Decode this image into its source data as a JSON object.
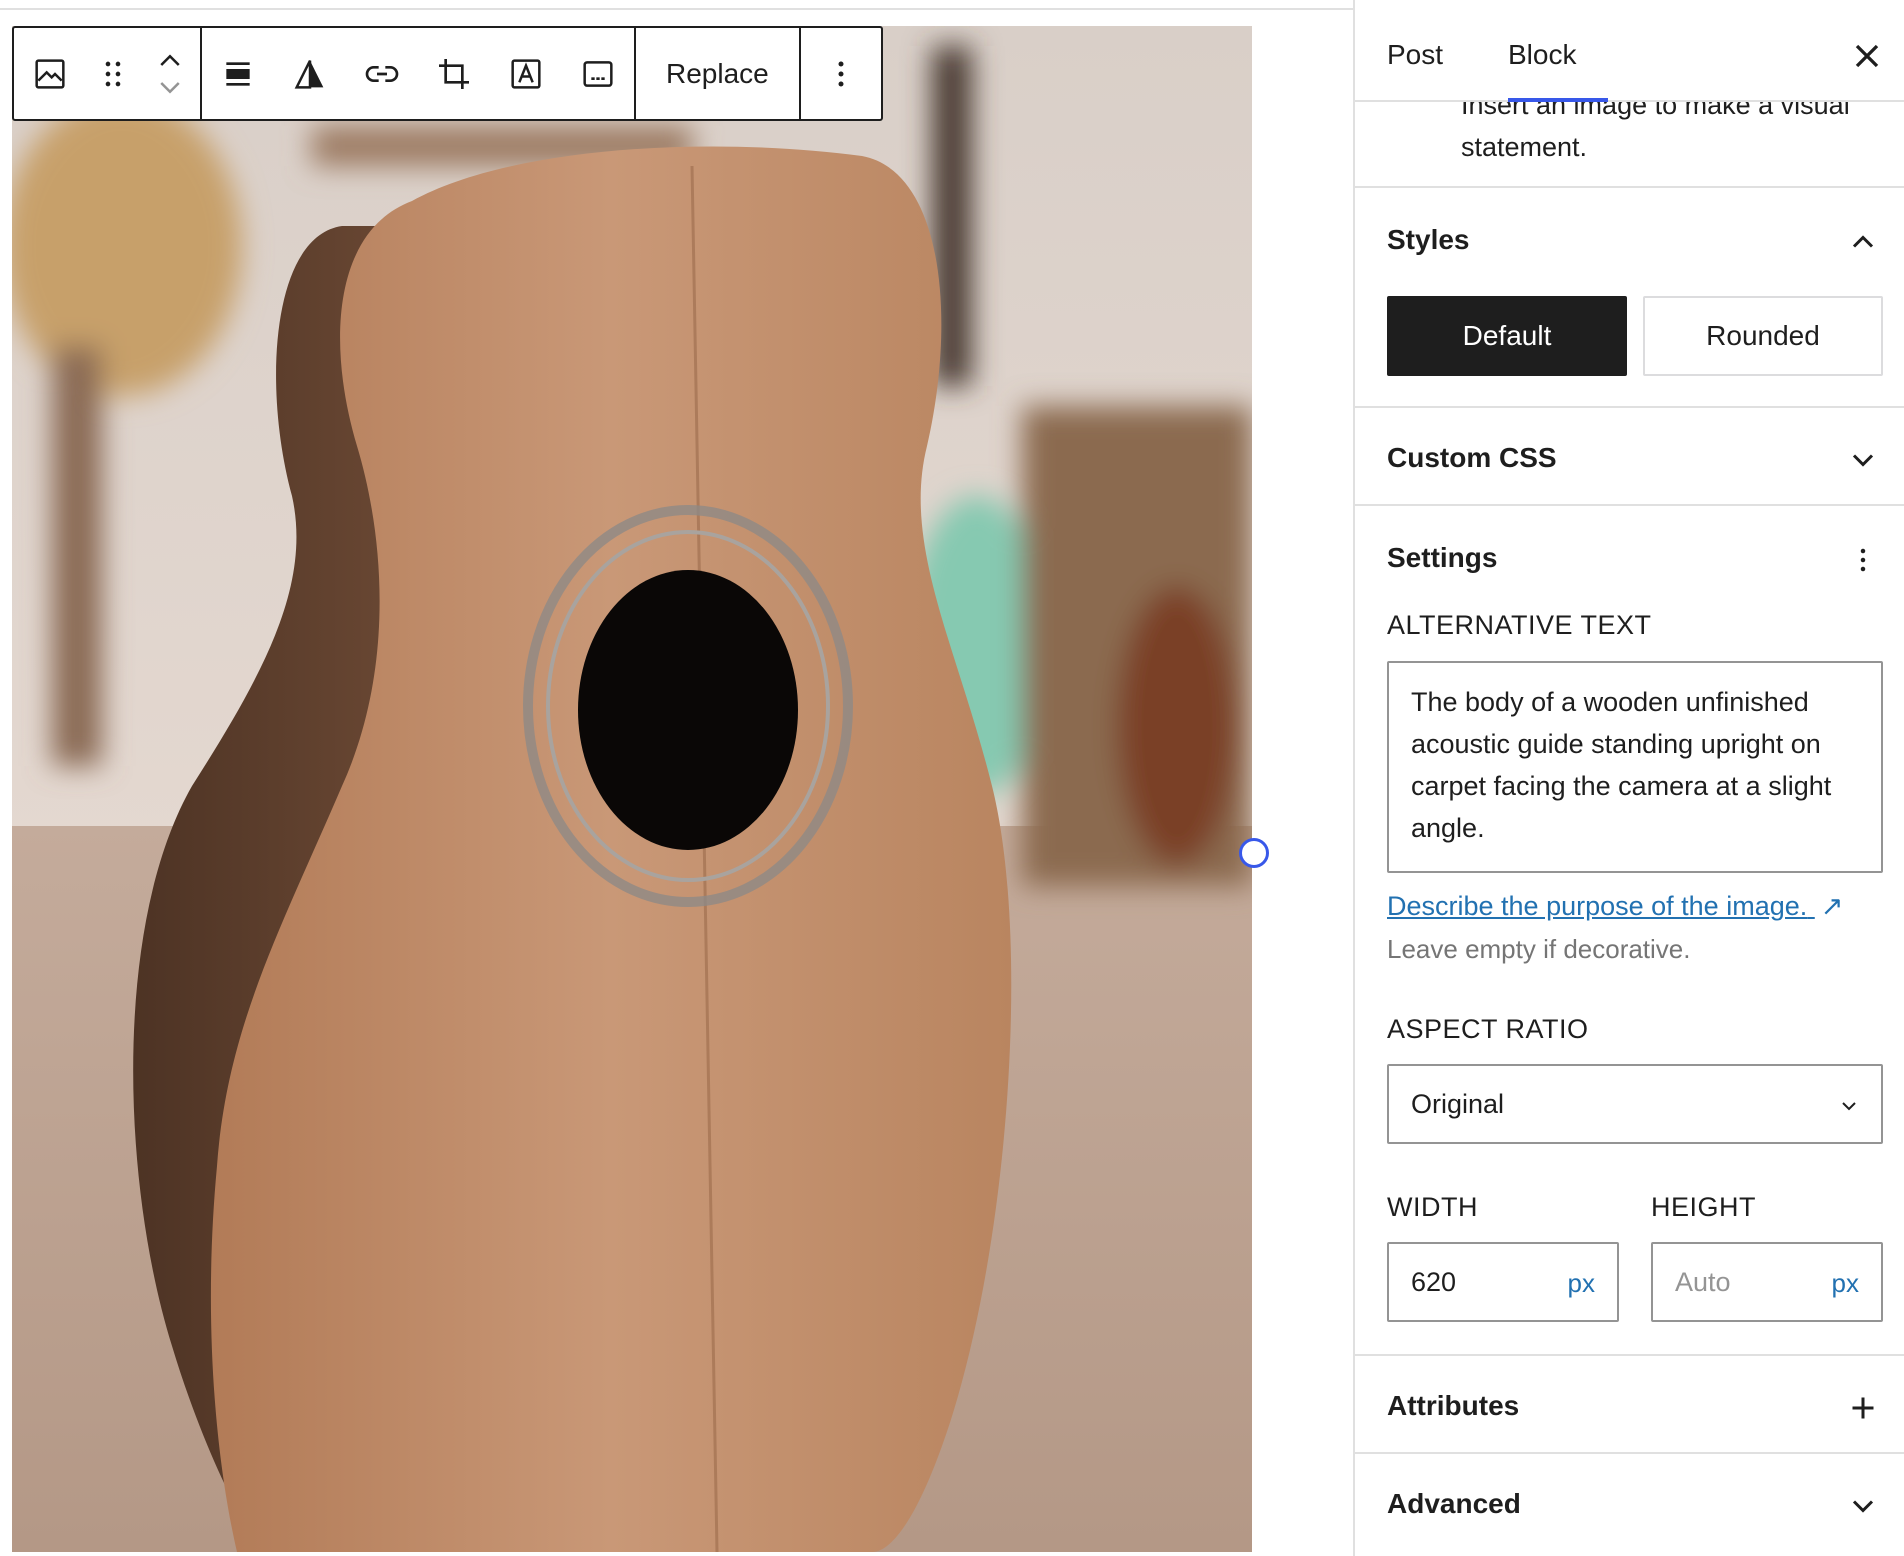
{
  "toolbar": {
    "replace_label": "Replace",
    "icons": [
      "image-block-icon",
      "drag-handle-icon",
      "move-up-icon",
      "move-down-icon",
      "align-icon",
      "duotone-icon",
      "link-icon",
      "crop-icon",
      "text-overlay-icon",
      "caption-icon",
      "more-options-icon"
    ]
  },
  "sidebar": {
    "tabs": {
      "post": "Post",
      "block": "Block"
    },
    "block_description": "Insert an image to make a visual statement.",
    "styles": {
      "title": "Styles",
      "options": [
        "Default",
        "Rounded"
      ],
      "selected": "Default"
    },
    "custom_css": {
      "title": "Custom CSS"
    },
    "settings": {
      "title": "Settings",
      "alt_label": "ALTERNATIVE TEXT",
      "alt_value": "The body of a wooden unfinished acoustic guide standing upright on carpet facing the camera at a slight angle.",
      "alt_link": "Describe the purpose of the image.",
      "alt_link_arrow": "↗",
      "alt_help": "Leave empty if decorative.",
      "aspect_label": "ASPECT RATIO",
      "aspect_value": "Original",
      "width_label": "WIDTH",
      "height_label": "HEIGHT",
      "width_value": "620",
      "height_placeholder": "Auto",
      "unit": "px"
    },
    "attributes": {
      "title": "Attributes"
    },
    "advanced": {
      "title": "Advanced"
    }
  },
  "colors": {
    "accent": "#3858e9",
    "link": "#2271b1",
    "dark": "#1e1e1e",
    "border": "#e0e0e0"
  }
}
